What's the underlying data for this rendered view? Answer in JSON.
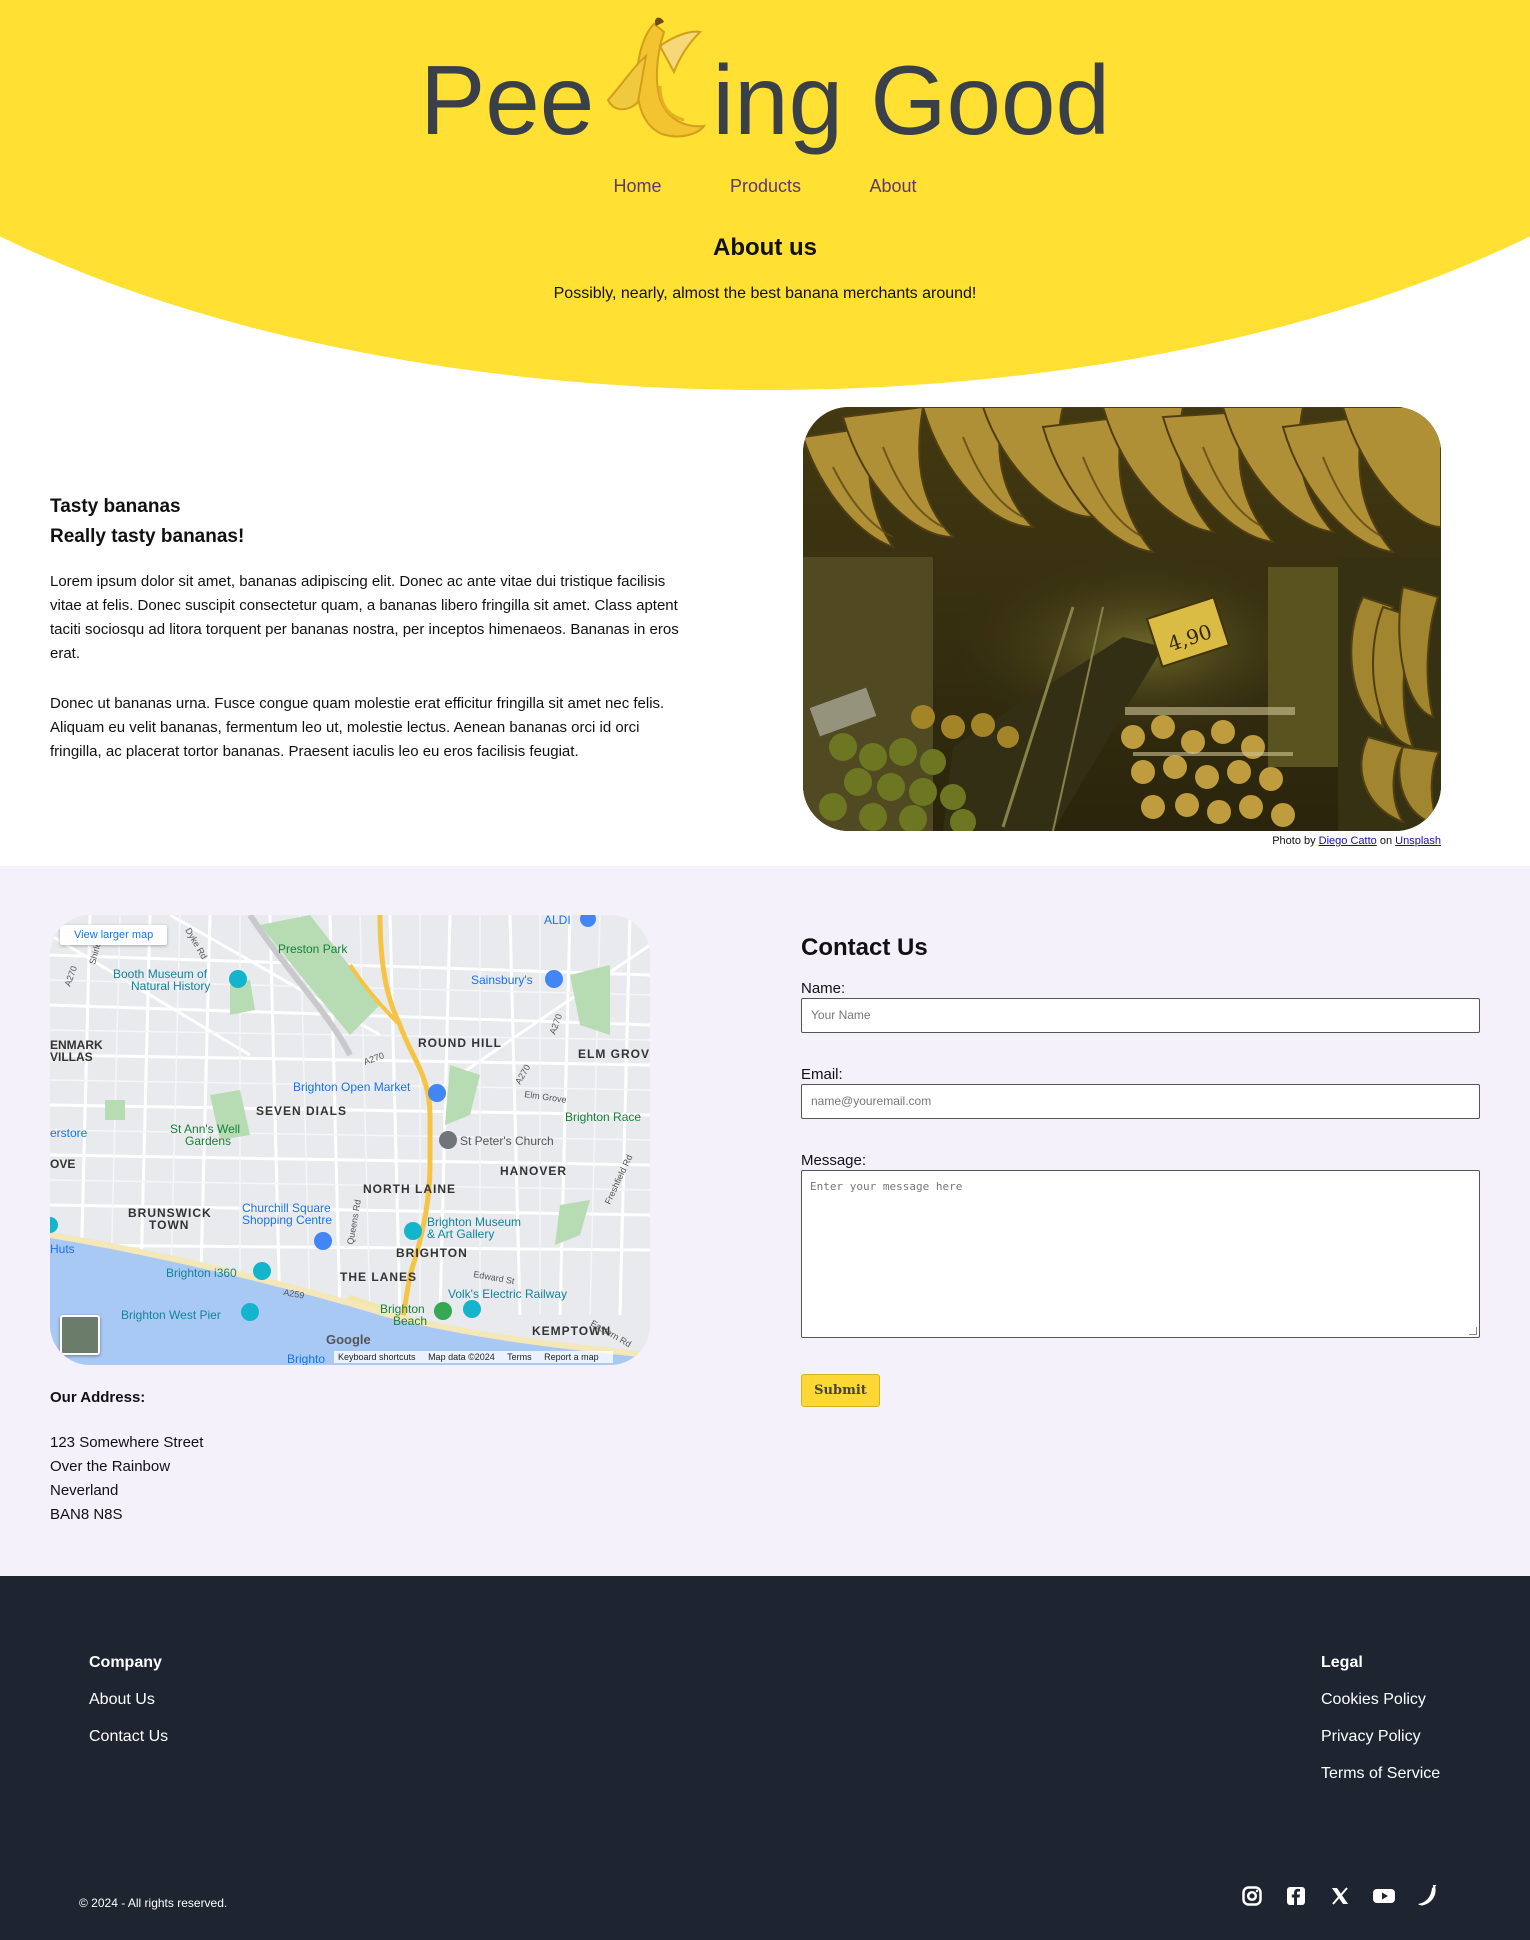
{
  "header": {
    "logo_left": "Pee",
    "logo_right": "ing Good",
    "nav": [
      "Home",
      "Products",
      "About"
    ],
    "title": "About us",
    "subtitle": "Possibly, nearly, almost the best banana merchants around!"
  },
  "about": {
    "heading1": "Tasty bananas",
    "heading2": "Really tasty bananas!",
    "para1": "Lorem ipsum dolor sit amet, bananas adipiscing elit. Donec ac ante vitae dui tristique facilisis vitae at felis. Donec suscipit consectetur quam, a bananas libero fringilla sit amet. Class aptent taciti sociosqu ad litora torquent per bananas nostra, per inceptos himenaeos. Bananas in eros erat.",
    "para2": "Donec ut bananas urna. Fusce congue quam molestie erat efficitur fringilla sit amet nec felis. Aliquam eu velit bananas, fermentum leo ut, molestie lectus. Aenean bananas orci id orci fringilla, ac placerat tortor bananas. Praesent iaculis leo eu eros facilisis feugiat.",
    "credit_prefix": "Photo by",
    "credit_author": "Diego Catto",
    "credit_on": "on",
    "credit_site": "Unsplash",
    "price_tag": "4,90"
  },
  "map": {
    "button": "View larger map",
    "labels": [
      "Preston Park",
      "Booth Museum of",
      "Natural History",
      "Sainsbury's",
      "ROUND HILL",
      "ELM GROV",
      "Brighton Open Market",
      "SEVEN DIALS",
      "Brighton Race",
      "St Ann's Well",
      "Gardens",
      "St Peter's Church",
      "HANOVER",
      "NORTH LAINE",
      "BRUNSWICK",
      "TOWN",
      "Churchill Square",
      "Shopping Centre",
      "Brighton Museum",
      "& Art Gallery",
      "BRIGHTON",
      "Brighton i360",
      "THE LANES",
      "Volk's Electric Railway",
      "Brighton West Pier",
      "Brighton",
      "Beach",
      "KEMPTOWN",
      "ALDI",
      "ENMARK",
      "VILLAS",
      "erstore",
      "OVE",
      "Huts",
      "Brighto"
    ],
    "roads": [
      "A270",
      "A270",
      "A270",
      "A270",
      "A259",
      "Dyke Rd",
      "Queens Rd",
      "Edward St",
      "Elm Grove",
      "Freshfield Rd",
      "Eastern Rd",
      "Shirley"
    ],
    "logo": "Google",
    "footer": [
      "Keyboard shortcuts",
      "Map data ©2024",
      "Terms",
      "Report a map"
    ]
  },
  "address": {
    "title": "Our Address:",
    "lines": [
      "123 Somewhere Street",
      "Over the Rainbow",
      "Neverland",
      "BAN8 N8S"
    ]
  },
  "contact": {
    "title": "Contact Us",
    "name_label": "Name:",
    "name_placeholder": "Your Name",
    "email_label": "Email:",
    "email_placeholder": "name@youremail.com",
    "message_label": "Message:",
    "message_placeholder": "Enter your message here",
    "submit": "Submit"
  },
  "footer": {
    "company_title": "Company",
    "company_links": [
      "About Us",
      "Contact Us"
    ],
    "legal_title": "Legal",
    "legal_links": [
      "Cookies Policy",
      "Privacy Policy",
      "Terms of Service"
    ],
    "copyright": "© 2024 - All rights reserved.",
    "social_icons": [
      "instagram-icon",
      "facebook-icon",
      "x-icon",
      "youtube-icon",
      "banana-icon"
    ]
  },
  "colors": {
    "brand_yellow": "#ffe033",
    "footer_bg": "#1e2530",
    "contact_bg": "#f5f1fb",
    "logo_text": "#3a4049"
  }
}
